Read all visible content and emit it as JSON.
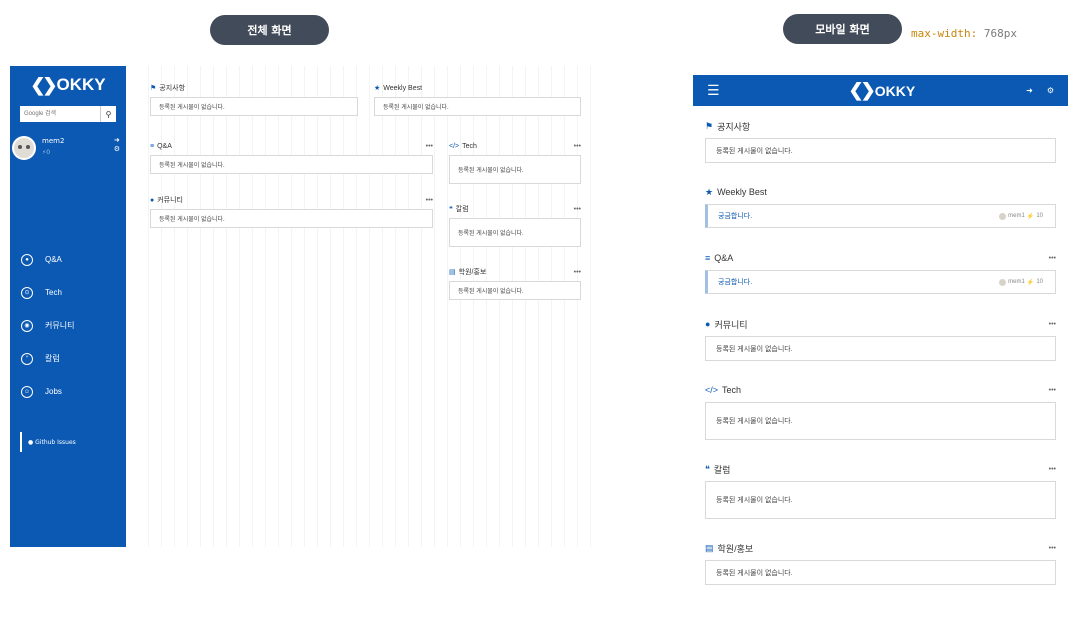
{
  "labels": {
    "full_screen": "전체 화면",
    "mobile_screen": "모바일 화면",
    "mq_prop": "max-width:",
    "mq_value": " 768px"
  },
  "brand": {
    "logo_text": "OKKY",
    "logo_mark": "❮❯"
  },
  "search": {
    "placeholder": "Google 검색"
  },
  "user": {
    "name": "mem2",
    "points": "0"
  },
  "nav": [
    {
      "label": "Q&A",
      "icon": "qna-icon"
    },
    {
      "label": "Tech",
      "icon": "tech-icon"
    },
    {
      "label": "커뮤니티",
      "icon": "community-icon"
    },
    {
      "label": "칼럼",
      "icon": "column-icon"
    },
    {
      "label": "Jobs",
      "icon": "jobs-icon"
    }
  ],
  "github_link": "Github Issues",
  "empty_text": "등록된 게시물이 없습니다.",
  "sections": {
    "notice": "공지사항",
    "weekly": "Weekly Best",
    "qna": "Q&A",
    "tech": "Tech",
    "community": "커뮤니티",
    "column": "칼럼",
    "academy": "학원/홍보"
  },
  "more": "•••",
  "featured_post": {
    "title": "궁금합니다.",
    "author": "mem1",
    "score": "10"
  }
}
